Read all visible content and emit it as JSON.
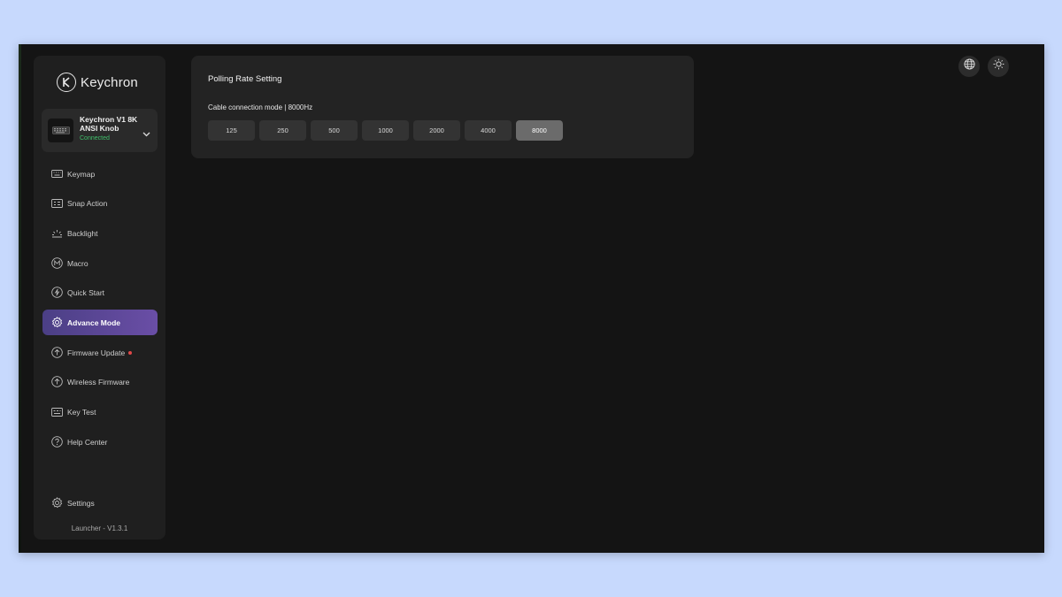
{
  "app": {
    "logo_text": "Keychron",
    "version": "Launcher - V1.3.1"
  },
  "device": {
    "name": "Keychron V1 8K ANSI Knob",
    "status": "Connected"
  },
  "sidebar": {
    "items": [
      {
        "label": "Keymap",
        "icon": "keyboard-icon"
      },
      {
        "label": "Snap Action",
        "icon": "snap-action-icon"
      },
      {
        "label": "Backlight",
        "icon": "backlight-icon"
      },
      {
        "label": "Macro",
        "icon": "macro-icon"
      },
      {
        "label": "Quick Start",
        "icon": "lightning-icon"
      },
      {
        "label": "Advance Mode",
        "icon": "gear-icon",
        "active": true
      },
      {
        "label": "Firmware Update",
        "icon": "upload-icon",
        "badge": "red-dot"
      },
      {
        "label": "Wireless Firmware",
        "icon": "upload-icon"
      },
      {
        "label": "Key Test",
        "icon": "key-test-icon"
      },
      {
        "label": "Help Center",
        "icon": "help-icon"
      }
    ],
    "settings_label": "Settings"
  },
  "polling": {
    "title": "Polling Rate Setting",
    "mode_label": "Cable connection mode | 8000Hz",
    "rates": [
      "125",
      "250",
      "500",
      "1000",
      "2000",
      "4000",
      "8000"
    ],
    "selected": "8000"
  },
  "toolbar": {
    "language_icon": "globe-icon",
    "theme_icon": "sun-icon"
  },
  "colors": {
    "accent": "#5a46a0",
    "status_connected": "#3fbf6a",
    "badge": "#e04848"
  }
}
